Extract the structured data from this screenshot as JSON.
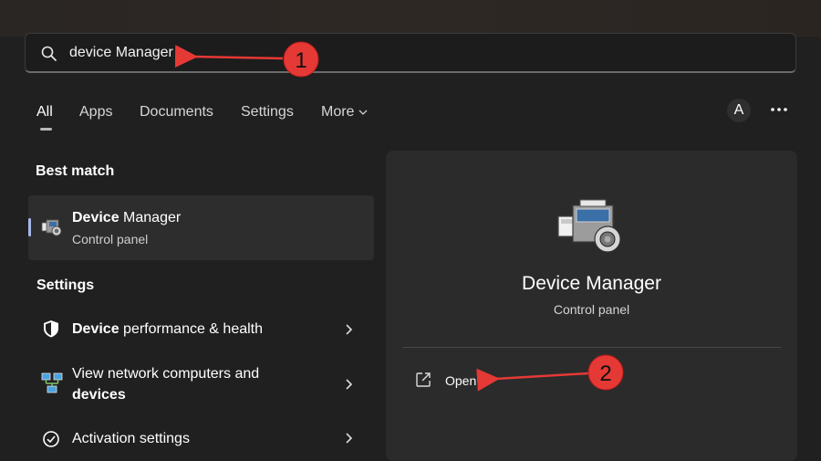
{
  "search": {
    "value": "device Manager"
  },
  "tabs": [
    {
      "label": "All",
      "active": true
    },
    {
      "label": "Apps"
    },
    {
      "label": "Documents"
    },
    {
      "label": "Settings"
    },
    {
      "label": "More"
    }
  ],
  "header": {
    "avatar_letter": "A",
    "more_icon": "ellipsis-icon"
  },
  "best_match": {
    "heading": "Best match",
    "item": {
      "title_bold": "Device",
      "title_rest": " Manager",
      "subtitle": "Control panel",
      "icon": "device-manager-icon"
    }
  },
  "settings": {
    "heading": "Settings",
    "items": [
      {
        "bold": "Device",
        "rest": " performance & health",
        "icon": "shield-icon"
      },
      {
        "line1": "View network computers and",
        "line2_bold": "devices",
        "icon": "network-computers-icon"
      },
      {
        "text": "Activation settings",
        "icon": "check-circle-icon"
      }
    ]
  },
  "preview": {
    "title": "Device Manager",
    "subtitle": "Control panel",
    "open_label": "Open",
    "icon": "device-manager-icon"
  },
  "annotations": [
    {
      "number": "1",
      "color": "#e53935"
    },
    {
      "number": "2",
      "color": "#e53935"
    }
  ],
  "colors": {
    "background": "#202020",
    "panel": "#2b2b2b",
    "selected_item": "#2d2d2d",
    "accent": "#a7b7e8",
    "annotation": "#e53935"
  }
}
